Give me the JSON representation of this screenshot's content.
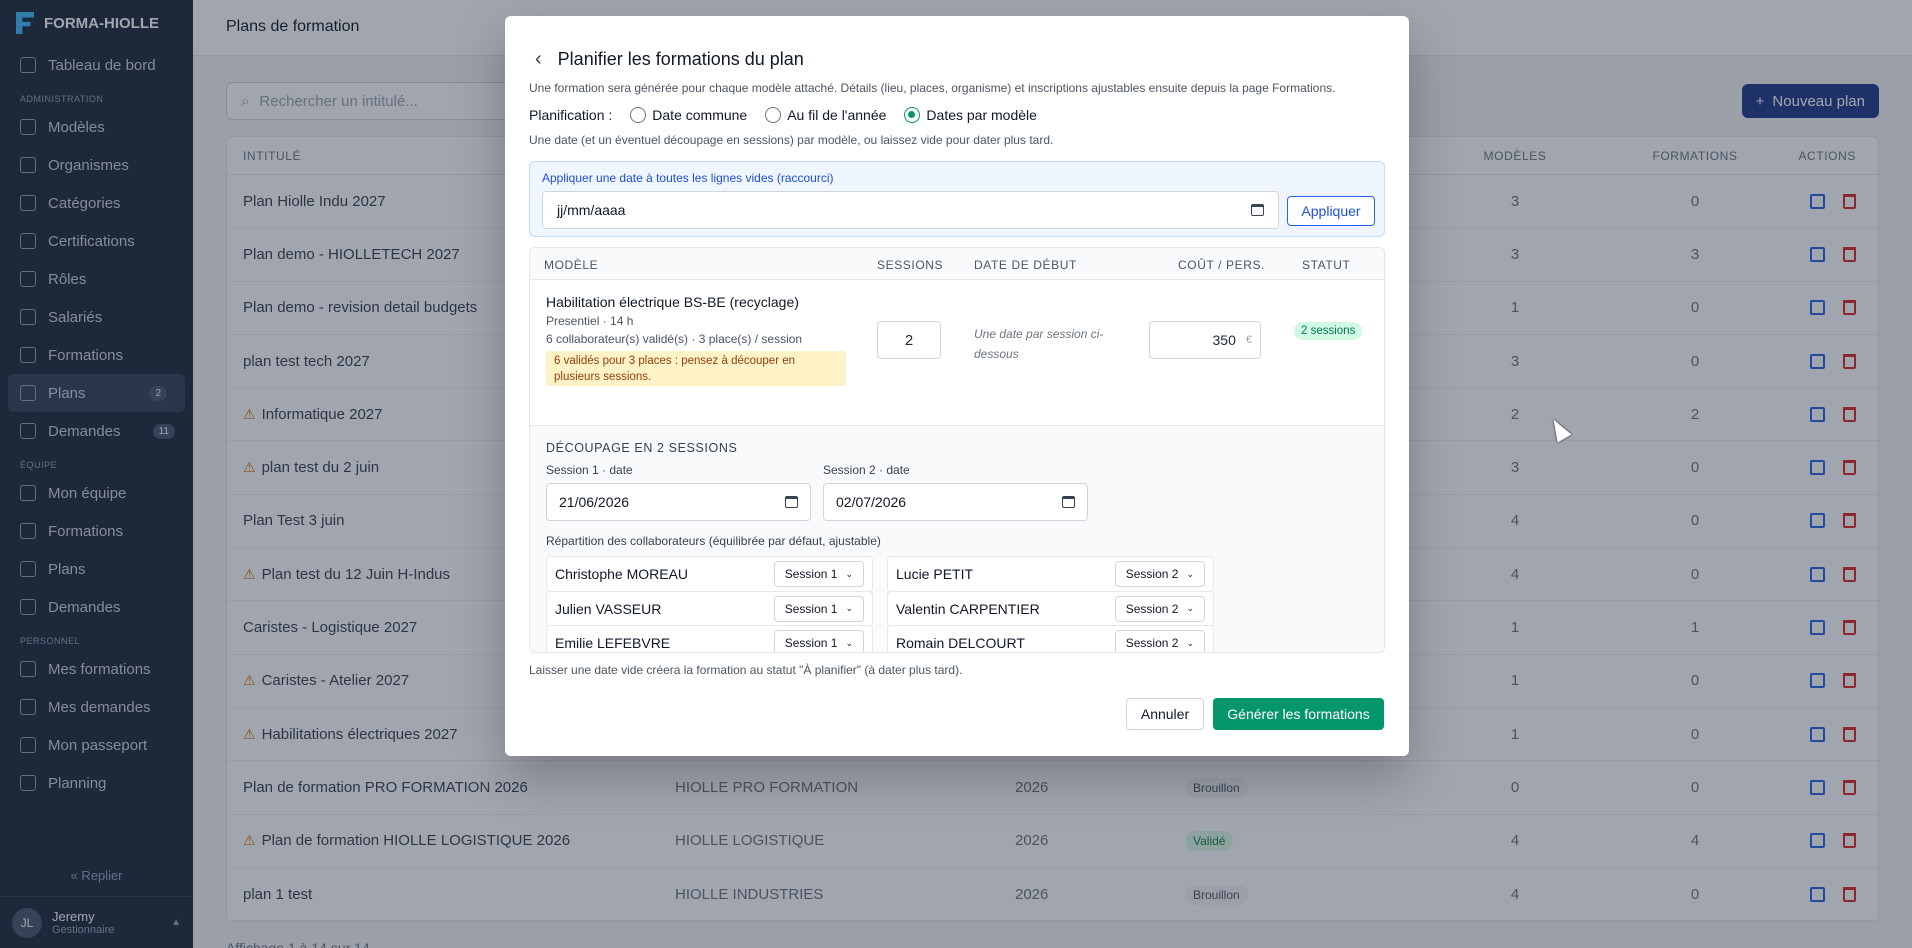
{
  "app": {
    "brand": "FORMA-HIOLLE"
  },
  "sidebar": {
    "dashboard": "Tableau de bord",
    "sec_admin": "ADMINISTRATION",
    "admin": [
      {
        "label": "Modèles"
      },
      {
        "label": "Organismes"
      },
      {
        "label": "Catégories"
      },
      {
        "label": "Certifications"
      },
      {
        "label": "Rôles"
      },
      {
        "label": "Salariés"
      },
      {
        "label": "Formations"
      },
      {
        "label": "Plans",
        "badge": "2"
      },
      {
        "label": "Demandes",
        "badge": "11"
      }
    ],
    "sec_team": "ÉQUIPE",
    "team": [
      {
        "label": "Mon équipe"
      },
      {
        "label": "Formations"
      },
      {
        "label": "Plans"
      },
      {
        "label": "Demandes"
      }
    ],
    "sec_personal": "PERSONNEL",
    "personal": [
      {
        "label": "Mes formations"
      },
      {
        "label": "Mes demandes"
      },
      {
        "label": "Mon passeport"
      },
      {
        "label": "Planning"
      }
    ],
    "replier": "Replier",
    "user": {
      "initials": "JL",
      "name": "Jeremy",
      "role": "Gestionnaire"
    }
  },
  "page": {
    "title": "Plans de formation",
    "search_placeholder": "Rechercher un intitulé...",
    "new_plan": "Nouveau plan",
    "pager": "Affichage 1 à 14 sur 14"
  },
  "table": {
    "headers": [
      "INTITULÉ",
      "",
      "",
      "",
      "MODÈLES",
      "FORMATIONS",
      "ACTIONS"
    ],
    "rows": [
      {
        "title": "Plan Hiolle Indu 2027",
        "warn": false,
        "modeles": "3",
        "formations": "0"
      },
      {
        "title": "Plan demo - HIOLLETECH 2027",
        "warn": false,
        "modeles": "3",
        "formations": "3"
      },
      {
        "title": "Plan demo - revision detail budgets",
        "warn": false,
        "modeles": "1",
        "formations": "0"
      },
      {
        "title": "plan test tech 2027",
        "warn": false,
        "modeles": "3",
        "formations": "0"
      },
      {
        "title": "Informatique 2027",
        "warn": true,
        "modeles": "2",
        "formations": "2"
      },
      {
        "title": "plan test du 2 juin",
        "warn": true,
        "modeles": "3",
        "formations": "0"
      },
      {
        "title": "Plan Test 3 juin",
        "warn": false,
        "modeles": "4",
        "formations": "0"
      },
      {
        "title": "Plan test du 12 Juin H-Indus",
        "warn": true,
        "modeles": "4",
        "formations": "0"
      },
      {
        "title": "Caristes - Logistique 2027",
        "warn": false,
        "modeles": "1",
        "formations": "1"
      },
      {
        "title": "Caristes - Atelier 2027",
        "warn": true,
        "modeles": "1",
        "formations": "0"
      },
      {
        "title": "Habilitations électriques 2027",
        "warn": true,
        "modeles": "1",
        "formations": "0"
      },
      {
        "title": "Plan de formation PRO FORMATION 2026",
        "warn": false,
        "org": "HIOLLE PRO FORMATION",
        "year": "2026",
        "status": "Brouillon",
        "status_type": "brouillon",
        "modeles": "0",
        "formations": "0"
      },
      {
        "title": "Plan de formation HIOLLE LOGISTIQUE 2026",
        "warn": true,
        "org": "HIOLLE LOGISTIQUE",
        "year": "2026",
        "status": "Validé",
        "status_type": "valide",
        "modeles": "4",
        "formations": "4"
      },
      {
        "title": "plan 1 test",
        "warn": false,
        "org": "HIOLLE INDUSTRIES",
        "year": "2026",
        "status": "Brouillon",
        "status_type": "brouillon",
        "modeles": "4",
        "formations": "0"
      }
    ]
  },
  "modal": {
    "title": "Planifier les formations du plan",
    "desc": "Une formation sera générée pour chaque modèle attaché. Détails (lieu, places, organisme) et inscriptions ajustables ensuite depuis la page Formations.",
    "planning_label": "Planification :",
    "options": [
      "Date commune",
      "Au fil de l'année",
      "Dates par modèle"
    ],
    "selected_option": "Dates par modèle",
    "hint": "Une date (et un éventuel découpage en sessions) par modèle, ou laissez vide pour dater plus tard.",
    "apply_title": "Appliquer une date à toutes les lignes vides (raccourci)",
    "apply_placeholder": "jj/mm/aaaa",
    "apply_btn": "Appliquer",
    "headers": [
      "MODÈLE",
      "SESSIONS",
      "DATE DE DÉBUT",
      "COÛT / PERS.",
      "STATUT"
    ],
    "model": {
      "title": "Habilitation électrique BS-BE (recyclage)",
      "meta1": "Presentiel · 14 h",
      "meta2": "6 collaborateur(s) validé(s) · 3 place(s) / session",
      "warning": "6 validés pour 3 places : pensez à découper en plusieurs sessions.",
      "sessions": "2",
      "date_note": "Une date par session ci-dessous",
      "cost": "350",
      "currency": "€",
      "status": "2 sessions"
    },
    "split": {
      "title": "DÉCOUPAGE EN 2 SESSIONS",
      "s1_label": "Session 1 · date",
      "s1_date": "21/06/2026",
      "s2_label": "Session 2 · date",
      "s2_date": "02/07/2026",
      "rep_title": "Répartition des collaborateurs (équilibrée par défaut, ajustable)",
      "people": [
        {
          "name": "Christophe MOREAU",
          "session": "Session 1"
        },
        {
          "name": "Lucie PETIT",
          "session": "Session 2"
        },
        {
          "name": "Julien VASSEUR",
          "session": "Session 1"
        },
        {
          "name": "Valentin CARPENTIER",
          "session": "Session 2"
        },
        {
          "name": "Emilie LEFEBVRE",
          "session": "Session 1"
        },
        {
          "name": "Romain DELCOURT",
          "session": "Session 2"
        }
      ]
    },
    "foot_note": "Laisser une date vide créera la formation au statut \"À planifier\" (à dater plus tard).",
    "cancel": "Annuler",
    "generate": "Générer les formations"
  },
  "colors": {
    "primary": "#059669",
    "sidebar": "#1e293b",
    "accent": "#1d4ed8"
  }
}
